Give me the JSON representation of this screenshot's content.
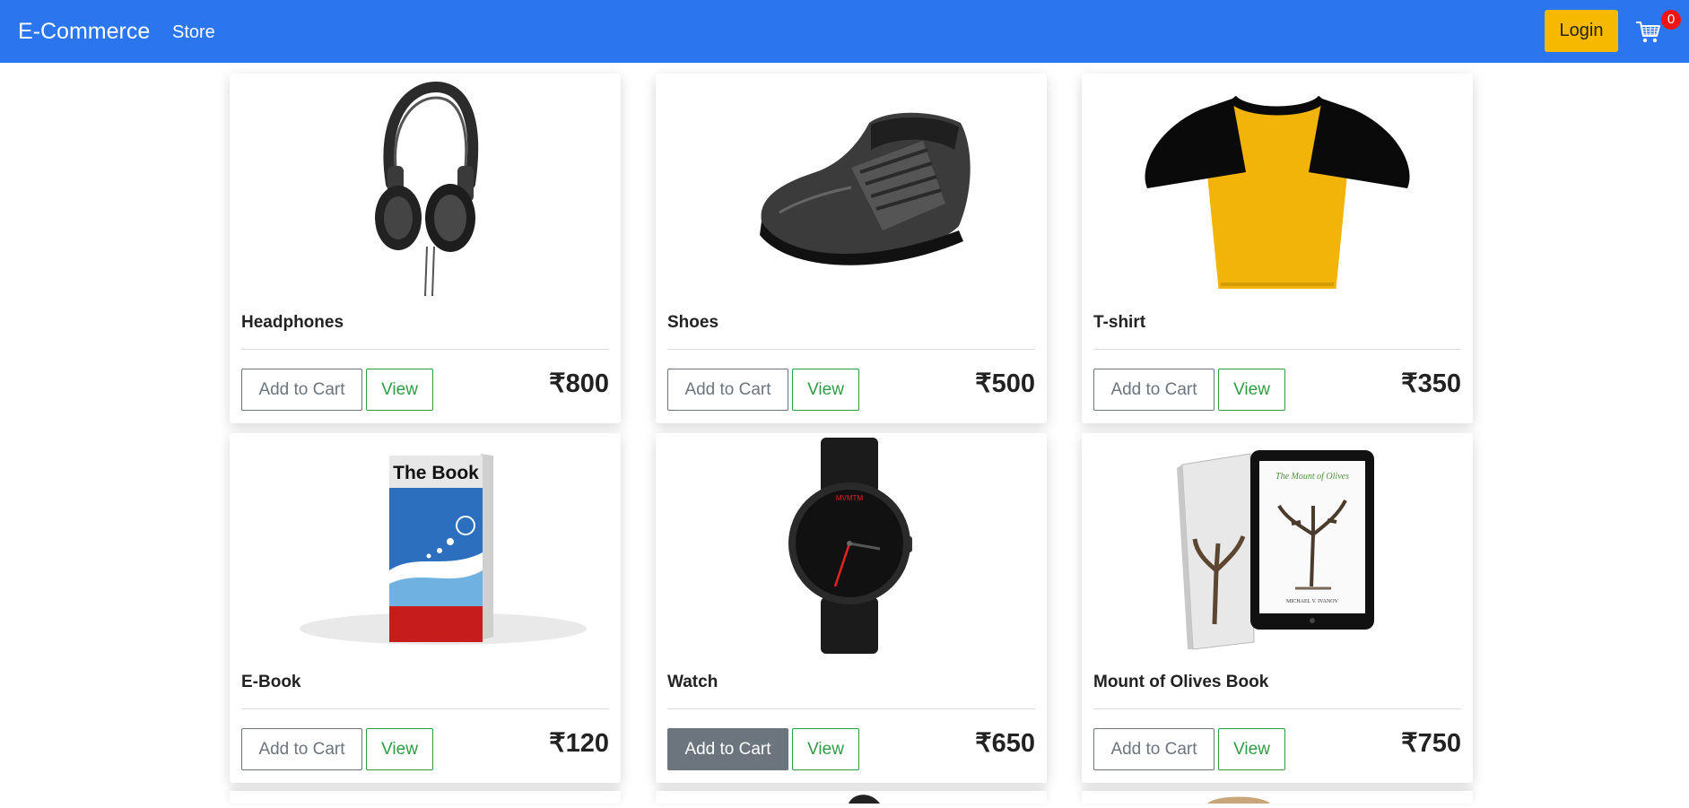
{
  "navbar": {
    "brand": "E-Commerce",
    "store_link": "Store",
    "login_label": "Login",
    "cart_count": "0",
    "cart_icon": "shopping-cart-icon",
    "background_color": "#2b76ef",
    "login_color": "#f6b900"
  },
  "buttons": {
    "add_to_cart": "Add to Cart",
    "view": "View"
  },
  "products": [
    {
      "name": "Headphones",
      "price": "₹800",
      "image_icon": "headphones-image"
    },
    {
      "name": "Shoes",
      "price": "₹500",
      "image_icon": "shoe-image"
    },
    {
      "name": "T-shirt",
      "price": "₹350",
      "image_icon": "tshirt-image"
    },
    {
      "name": "E-Book",
      "price": "₹120",
      "image_icon": "book-image",
      "cover_text": "The Book"
    },
    {
      "name": "Watch",
      "price": "₹650",
      "image_icon": "watch-image",
      "watch_brand": "MVMTM"
    },
    {
      "name": "Mount of Olives Book",
      "price": "₹750",
      "image_icon": "olives-book-image",
      "cover_title": "The Mount of Olives",
      "cover_author": "MICHAEL V. IVANOV"
    }
  ]
}
